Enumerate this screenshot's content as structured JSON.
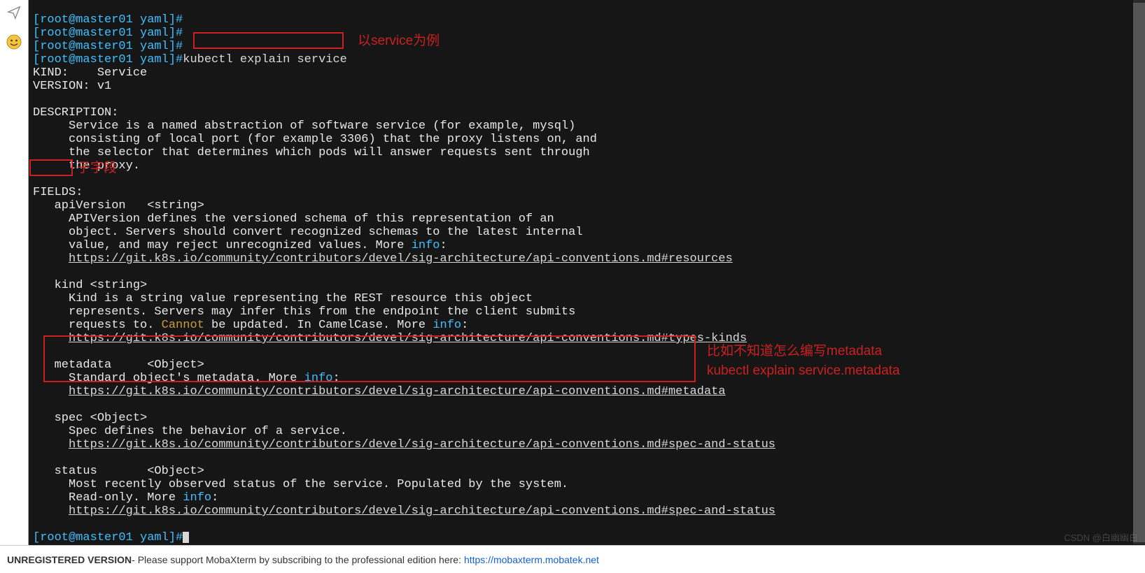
{
  "sidebar": {
    "icon1": "paper-plane-icon",
    "icon2": "emoji-icon"
  },
  "prompts": {
    "p": "[root@master01 yaml]#",
    "cmd": "kubectl explain service"
  },
  "out": {
    "kind_label": "KIND:    ",
    "kind_val": "Service",
    "ver_label": "VERSION: ",
    "ver_val": "v1",
    "desc_h": "DESCRIPTION:",
    "d1": "     Service is a named abstraction of software service (for example, mysql)",
    "d2": "     consisting of local port (for example 3306) that the proxy listens on, and",
    "d3": "     the selector that determines which pods will answer requests sent through",
    "d4": "     the proxy.",
    "fields_h": "FIELDS:",
    "f1_name": "   apiVersion   <string>",
    "f1_l1": "     APIVersion defines the versioned schema of this representation of an",
    "f1_l2": "     object. Servers should convert recognized schemas to the latest internal",
    "f1_l3a": "     value, and may reject unrecognized values. More ",
    "info": "info",
    "colon": ":",
    "url_res": "https://git.k8s.io/community/contributors/devel/sig-architecture/api-conventions.md#resources",
    "f2_name": "   kind <string>",
    "f2_l1": "     Kind is a string value representing the REST resource this object",
    "f2_l2": "     represents. Servers may infer this from the endpoint the client submits",
    "f2_l3a": "     requests to. ",
    "cannot": "Cannot",
    "f2_l3b": " be updated. In CamelCase. More ",
    "url_kinds": "https://git.k8s.io/community/contributors/devel/sig-architecture/api-conventions.md#types-kinds",
    "f3_name": "   metadata     <Object>",
    "f3_l1a": "     Standard object's metadata. More ",
    "url_meta": "https://git.k8s.io/community/contributors/devel/sig-architecture/api-conventions.md#metadata",
    "f4_name": "   spec <Object>",
    "f4_l1": "     Spec defines the behavior of a service.",
    "url_spec": "https://git.k8s.io/community/contributors/devel/sig-architecture/api-conventions.md#spec-and-status",
    "f5_name": "   status       <Object>",
    "f5_l1": "     Most recently observed status of the service. Populated by the system.",
    "f5_l2a": "     Read-only. More ",
    "indent5": "     "
  },
  "annot": {
    "a1": "以service为例",
    "a2": "子字段",
    "a3_l1": "比如不知道怎么编写metadata",
    "a3_l2": "kubectl explain service.metadata"
  },
  "footer": {
    "bold": "UNREGISTERED VERSION",
    "text": " -  Please support MobaXterm by subscribing to the professional edition here:  ",
    "link": "https://mobaxterm.mobatek.net"
  },
  "watermark": "CSDN @白幽幽白"
}
